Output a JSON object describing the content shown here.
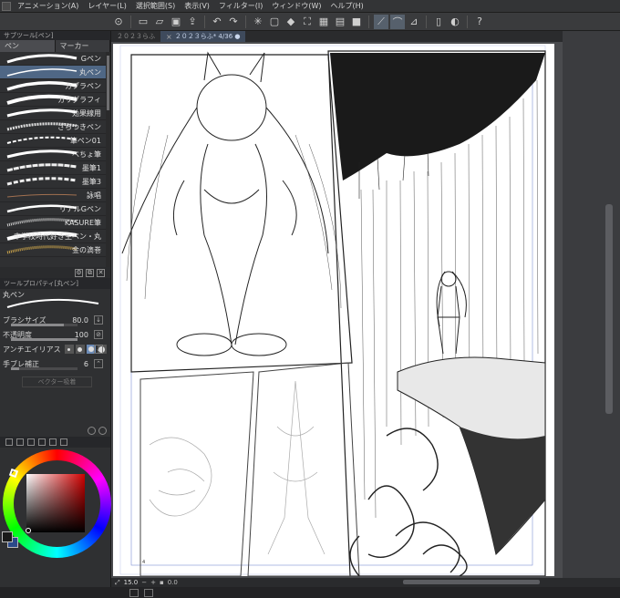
{
  "menu": [
    "アニメーション(A)",
    "レイヤー(L)",
    "選択範囲(S)",
    "表示(V)",
    "フィルター(I)",
    "ウィンドウ(W)",
    "ヘルプ(H)"
  ],
  "doc_tabs": [
    "２０２３らふ",
    "２０２３らふ* 4/36 ●"
  ],
  "sub_tool": {
    "header": "サブツール[ペン]",
    "tabs": [
      "ペン",
      "マーカー"
    ],
    "brushes": [
      "Gペン",
      "丸ペン",
      "カブラペン",
      "カリグラフィ",
      "効果線用",
      "ざらつきペン",
      "筆ペン01",
      "べちょ筆",
      "墨筆1",
      "墨筆3",
      "詠唱",
      "リアルGペン",
      "KASURE筆",
      "中学校時代好き生ペン・丸",
      "金の滴巻"
    ],
    "selected": "丸ペン"
  },
  "tool_property": {
    "header": "ツールプロパティ[丸ペン]",
    "preview_name": "丸ペン",
    "brush_size_label": "ブラシサイズ",
    "brush_size_value": "80.0",
    "brush_size_fraction": 0.8,
    "opacity_label": "不透明度",
    "opacity_value": "100",
    "opacity_fraction": 1.0,
    "antialias_label": "アンチエイリアス",
    "stabilize_label": "手ブレ補正",
    "stabilize_value": "6",
    "stabilize_fraction": 0.12,
    "vector_label": "ベクター吸着"
  },
  "status": {
    "zoom": "15.0",
    "angle": "0.0"
  },
  "page": {
    "number": "4"
  },
  "colors": {
    "accent": "#4f6785",
    "foreground": "#1a1a1a",
    "background_swatch": "#2c4a8a"
  }
}
